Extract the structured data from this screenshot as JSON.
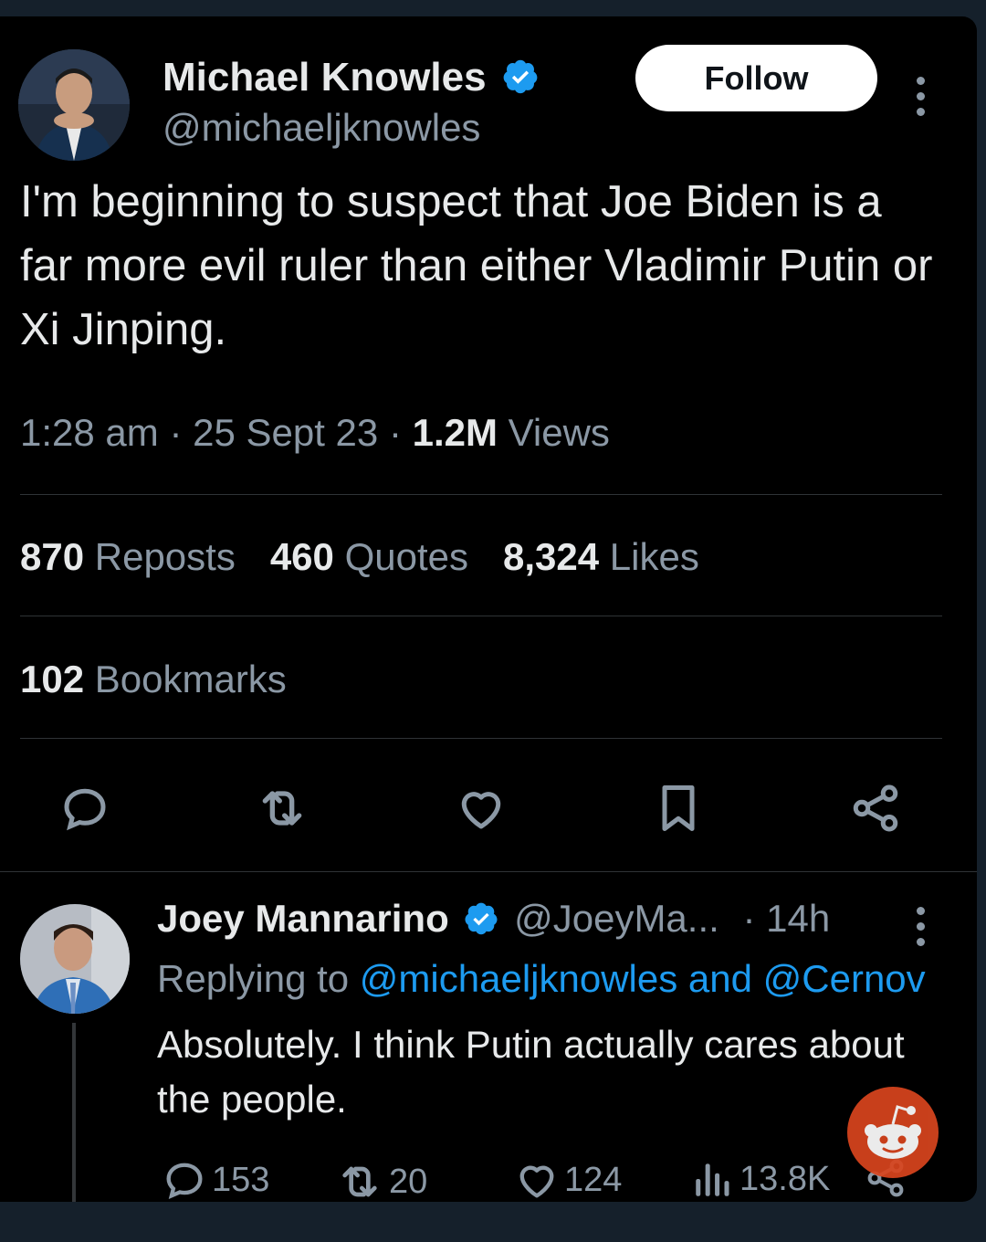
{
  "tweet": {
    "author_name": "Michael Knowles",
    "author_handle": "@michaeljknowles",
    "follow_label": "Follow",
    "text": "I'm beginning to suspect that Joe Biden is a far more evil ruler than either Vladimir Putin or Xi Jinping.",
    "time": "1:28 am",
    "date": "25 Sept 23",
    "views_count": "1.2M",
    "views_label": "Views",
    "reposts_count": "870",
    "reposts_label": "Reposts",
    "quotes_count": "460",
    "quotes_label": "Quotes",
    "likes_count": "8,324",
    "likes_label": "Likes",
    "bookmarks_count": "102",
    "bookmarks_label": "Bookmarks",
    "actions": [
      "reply-icon",
      "repost-icon",
      "like-icon",
      "bookmark-icon",
      "share-icon"
    ]
  },
  "reply": {
    "author_name": "Joey Mannarino",
    "author_handle": "@JoeyMa...",
    "age": "· 14h",
    "replying_prefix": "Replying to",
    "replying_to": "@michaeljknowles and @Cernov",
    "text": "Absolutely. I think Putin actually cares about the people.",
    "replies": "153",
    "reposts": "20",
    "likes": "124",
    "views": "13.8K"
  },
  "colors": {
    "background": "#000000",
    "frame": "#15202b",
    "text": "#e7e9ea",
    "muted": "#8b98a5",
    "link": "#1d9bf0",
    "verified": "#1d9bf0",
    "reddit_badge": "#d9451e"
  }
}
